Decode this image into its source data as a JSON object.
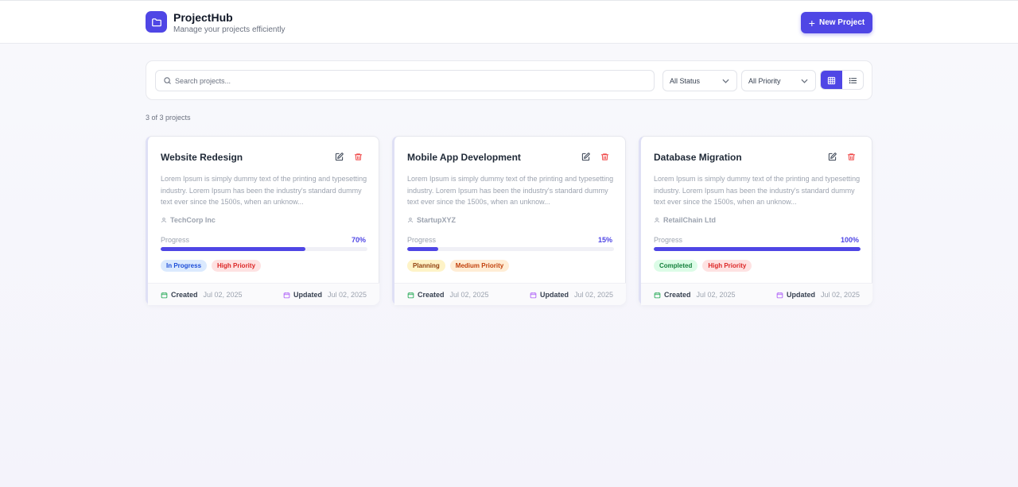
{
  "header": {
    "title": "ProjectHub",
    "subtitle": "Manage your projects efficiently",
    "new_button_label": "New Project",
    "logo_icon": "folder-icon"
  },
  "filters": {
    "search_placeholder": "Search projects...",
    "search_value": "",
    "status_selected": "All Status",
    "priority_selected": "All Priority",
    "view_mode": "grid"
  },
  "count_text": "3 of 3 projects",
  "labels": {
    "progress": "Progress",
    "created": "Created",
    "updated": "Updated"
  },
  "projects": [
    {
      "title": "Website Redesign",
      "description": "Lorem Ipsum is simply dummy text of the printing and typesetting industry. Lorem Ipsum has been the industry's standard dummy text ever since the 1500s, when an unknow...",
      "client": "TechCorp Inc",
      "progress": 70,
      "progress_text": "70%",
      "status": "In Progress",
      "priority": "High Priority",
      "created": "Jul 02, 2025",
      "updated": "Jul 02, 2025"
    },
    {
      "title": "Mobile App Development",
      "description": "Lorem Ipsum is simply dummy text of the printing and typesetting industry. Lorem Ipsum has been the industry's standard dummy text ever since the 1500s, when an unknow...",
      "client": "StartupXYZ",
      "progress": 15,
      "progress_text": "15%",
      "status": "Planning",
      "priority": "Medium Priority",
      "created": "Jul 02, 2025",
      "updated": "Jul 02, 2025"
    },
    {
      "title": "Database Migration",
      "description": "Lorem Ipsum is simply dummy text of the printing and typesetting industry. Lorem Ipsum has been the industry's standard dummy text ever since the 1500s, when an unknow...",
      "client": "RetailChain Ltd",
      "progress": 100,
      "progress_text": "100%",
      "status": "Completed",
      "priority": "High Priority",
      "created": "Jul 02, 2025",
      "updated": "Jul 02, 2025"
    }
  ],
  "colors": {
    "accent": "#4f46e5",
    "danger": "#ef4444",
    "created_icon": "#16a34a",
    "updated_icon": "#a855f7"
  }
}
